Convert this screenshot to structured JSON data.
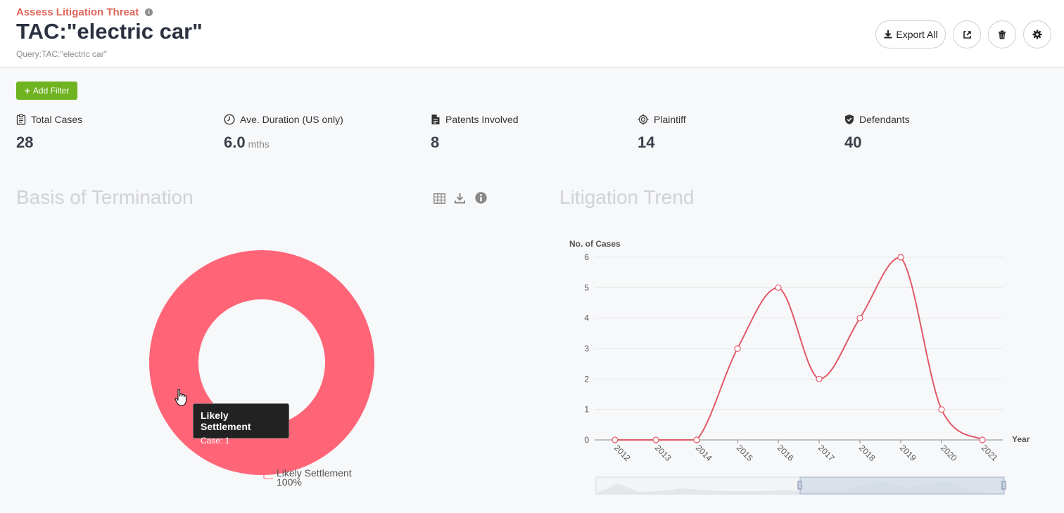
{
  "header": {
    "subtitle": "Assess Litigation Threat",
    "title": "TAC:\"electric car\"",
    "query": "Query:TAC:\"electric car\""
  },
  "toolbar": {
    "export_label": "Export All",
    "icons": [
      "download-icon",
      "share-icon",
      "trash-icon",
      "gear-icon"
    ]
  },
  "filters": {
    "add_label": "Add Filter"
  },
  "stats": [
    {
      "label": "Total Cases",
      "value": "28",
      "icon": "clipboard-icon"
    },
    {
      "label": "Ave. Duration (US only)",
      "value": "6.0",
      "unit": "mths",
      "icon": "clock-icon"
    },
    {
      "label": "Patents Involved",
      "value": "8",
      "icon": "document-icon"
    },
    {
      "label": "Plaintiff",
      "value": "14",
      "icon": "target-icon"
    },
    {
      "label": "Defendants",
      "value": "40",
      "icon": "shield-icon"
    }
  ],
  "termination": {
    "title": "Basis of Termination",
    "legend_label": "Likely Settlement",
    "legend_percent": "100%",
    "tooltip": {
      "title": "Likely Settlement",
      "value": "Case: 1"
    },
    "colors": {
      "slice": "#ff6577"
    }
  },
  "trend": {
    "title": "Litigation Trend",
    "colors": {
      "line": "#e05a66"
    }
  },
  "chart_data": [
    {
      "type": "pie",
      "variant": "donut",
      "labels": [
        "Likely Settlement"
      ],
      "values": [
        1
      ],
      "percent_labels": [
        "100%"
      ]
    },
    {
      "type": "line",
      "smooth": true,
      "ylabel": "No. of Cases",
      "xlabel": "Year",
      "x": [
        "2012",
        "2013",
        "2014",
        "2015",
        "2016",
        "2017",
        "2018",
        "2019",
        "2020",
        "2021"
      ],
      "series": [
        {
          "values": [
            0,
            0,
            0,
            3,
            5,
            2,
            4,
            6,
            1,
            0
          ]
        }
      ],
      "yticks": [
        "0",
        "1",
        "2",
        "3",
        "4",
        "5",
        "6"
      ],
      "ylim": [
        0,
        6
      ],
      "grid": true
    }
  ]
}
